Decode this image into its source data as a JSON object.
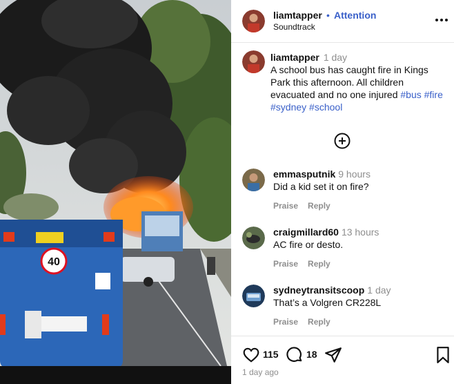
{
  "post": {
    "username": "liamtapper",
    "separator": "•",
    "follow_label": "Attention",
    "audio": "Soundtrack",
    "more_icon": "more-horizontal-icon"
  },
  "caption": {
    "username": "liamtapper",
    "time": "1 day",
    "text": "A school bus has caught fire in Kings Park this afternoon. All children evacuated and no one injured",
    "hashtags": [
      "#bus",
      "#fire",
      "#sydney",
      "#school"
    ]
  },
  "load_more_icon": "plus-circle-icon",
  "comments": [
    {
      "username": "emmasputnik",
      "time": "9 hours",
      "text": "Did a kid set it on fire?",
      "like_label": "Praise",
      "reply_label": "Reply"
    },
    {
      "username": "craigmillard60",
      "time": "13 hours",
      "text": "AC fire or desto.",
      "like_label": "Praise",
      "reply_label": "Reply"
    },
    {
      "username": "sydneytransitscoop",
      "time": "1 day",
      "text": "That’s a Volgren CR228L",
      "like_label": "Praise",
      "reply_label": "Reply"
    }
  ],
  "footer": {
    "likes": "115",
    "comments": "18",
    "posted": "1 day ago"
  },
  "media": {
    "bus_sign": "40"
  },
  "colors": {
    "accent": "#3a60c9",
    "muted": "#8e8e8e"
  }
}
